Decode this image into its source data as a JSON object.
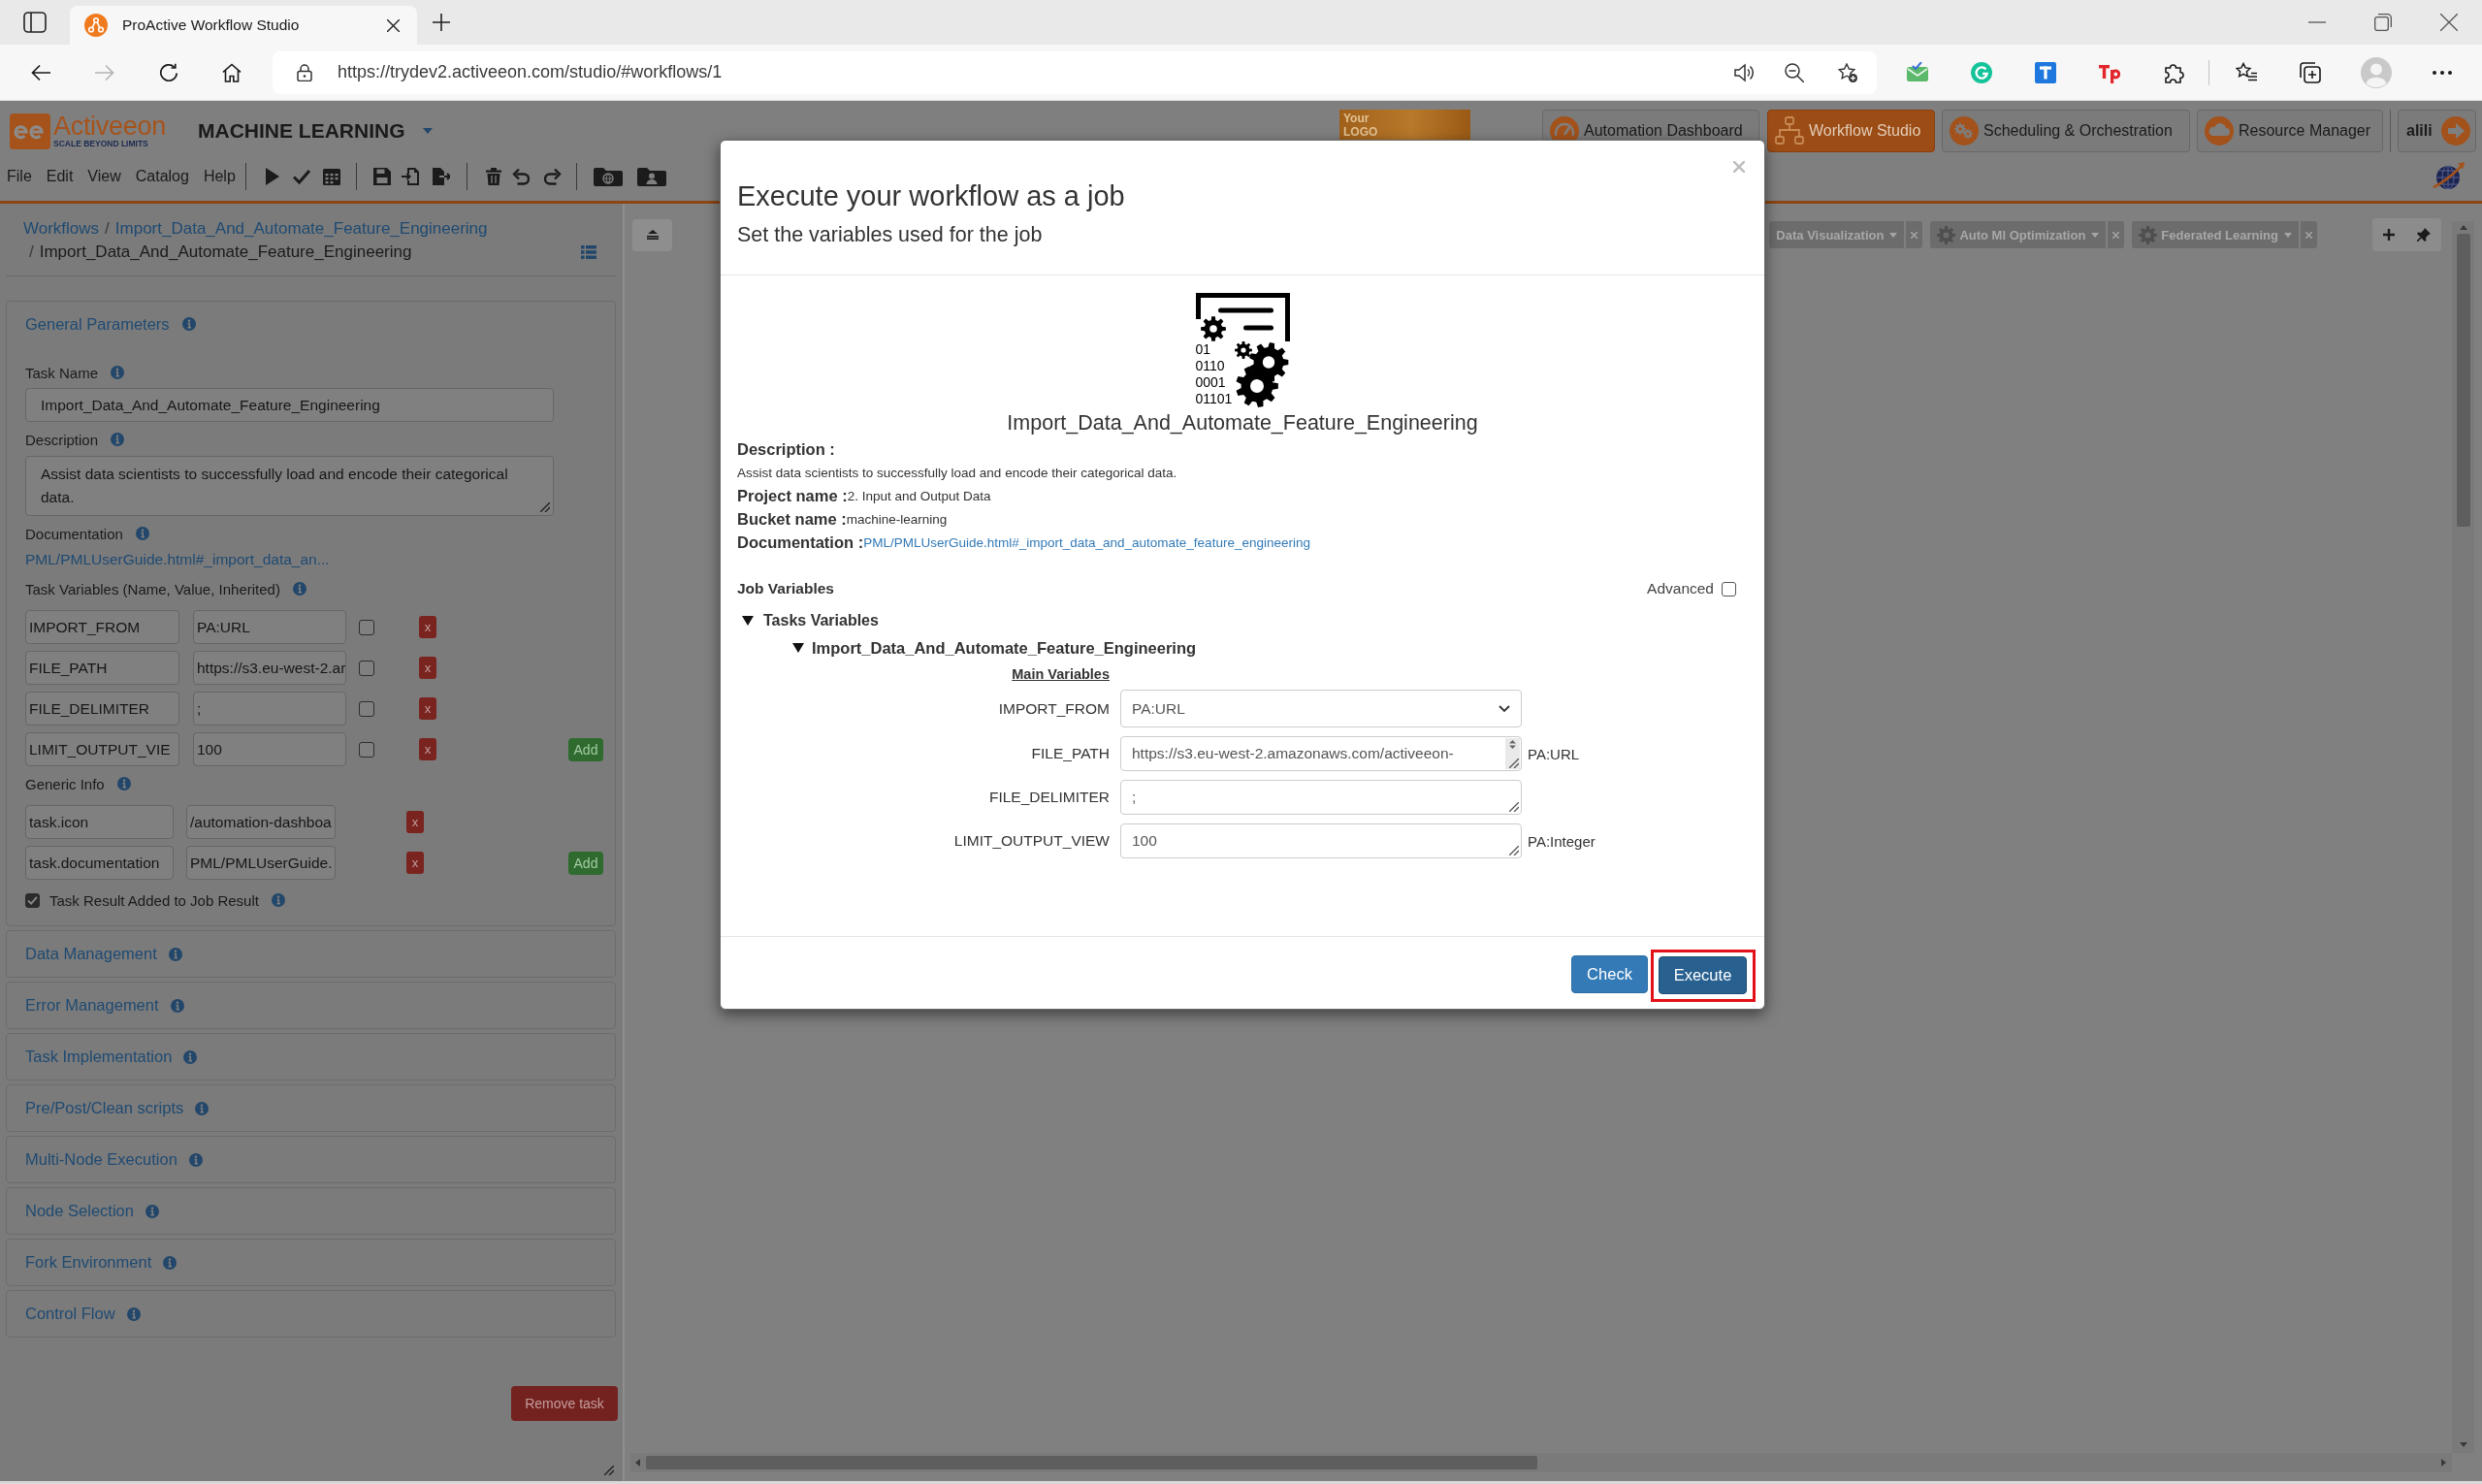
{
  "browser": {
    "tab_title": "ProActive Workflow Studio",
    "url": "https://trydev2.activeeon.com/studio/#workflows/1"
  },
  "header": {
    "logo": {
      "name": "Activeeon",
      "tagline": "SCALE BEYOND LIMITS"
    },
    "portal": "MACHINE LEARNING",
    "custom_logo": "Your LOGO",
    "nav": [
      {
        "label": "Automation Dashboard",
        "selected": false
      },
      {
        "label": "Workflow Studio",
        "selected": true
      },
      {
        "label": "Scheduling & Orchestration",
        "selected": false
      },
      {
        "label": "Resource Manager",
        "selected": false
      }
    ],
    "user": "alili"
  },
  "menu": [
    "File",
    "Edit",
    "View",
    "Catalog",
    "Help"
  ],
  "task_panel": {
    "breadcrumb": [
      {
        "label": "Workflows",
        "link": true
      },
      {
        "separator": "/",
        "label": "Import_Data_And_Automate_Feature_Engineering",
        "link": true
      },
      {
        "separator": "/",
        "label": "Import_Data_And_Automate_Feature_Engineering",
        "link": false
      }
    ],
    "general": {
      "title": "General Parameters",
      "task_name": {
        "label": "Task Name",
        "value": "Import_Data_And_Automate_Feature_Engineering"
      },
      "description": {
        "label": "Description",
        "value": "Assist data scientists to successfully load and encode their categorical data."
      },
      "documentation": {
        "label": "Documentation",
        "link": "PML/PMLUserGuide.html#_import_data_an..."
      },
      "variables": {
        "label": "Task Variables (Name, Value, Inherited)",
        "rows": [
          {
            "name": "IMPORT_FROM",
            "value": "PA:URL",
            "inherited": false,
            "remove": "x"
          },
          {
            "name": "FILE_PATH",
            "value": "https://s3.eu-west-2.ar",
            "inherited": false,
            "remove": "x"
          },
          {
            "name": "FILE_DELIMITER",
            "value": ";",
            "inherited": false,
            "remove": "x"
          },
          {
            "name": "LIMIT_OUTPUT_VIE",
            "value": "100",
            "inherited": false,
            "remove": "x"
          }
        ],
        "add": "Add"
      },
      "generic_info": {
        "label": "Generic Info",
        "rows": [
          {
            "name": "task.icon",
            "value": "/automation-dashboa",
            "remove": "x"
          },
          {
            "name": "task.documentation",
            "value": "PML/PMLUserGuide.",
            "remove": "x"
          }
        ],
        "add": "Add"
      },
      "result": {
        "label": "Task Result Added to Job Result",
        "checked": true
      }
    },
    "sections": [
      "Data Management",
      "Error Management",
      "Task Implementation",
      "Pre/Post/Clean scripts",
      "Multi-Node Execution",
      "Node Selection",
      "Fork Environment",
      "Control Flow"
    ],
    "remove_button": "Remove task"
  },
  "canvas": {
    "palettes": [
      {
        "label": "Data Visualization",
        "icon": false
      },
      {
        "label": "Auto Ml Optimization",
        "icon": true
      },
      {
        "label": "Federated Learning",
        "icon": true
      }
    ]
  },
  "modal": {
    "title": "Execute your workflow as a job",
    "subtitle": "Set the variables used for the job",
    "digits": [
      "01",
      "0110",
      "0001",
      "01101"
    ],
    "workflow_name": "Import_Data_And_Automate_Feature_Engineering",
    "details": [
      {
        "label": "Description :",
        "value": "Assist data scientists to successfully load and encode their categorical data.",
        "kind": "block"
      },
      {
        "label": "Project name :",
        "value": "2. Input and Output Data",
        "kind": "inline"
      },
      {
        "label": "Bucket name :",
        "value": "machine-learning",
        "kind": "inline"
      },
      {
        "label": "Documentation :",
        "value": "PML/PMLUserGuide.html#_import_data_and_automate_feature_engineering",
        "kind": "link"
      }
    ],
    "job_variables": {
      "title": "Job Variables",
      "advanced": {
        "label": "Advanced",
        "checked": false
      },
      "tree": [
        {
          "label": "Tasks Variables",
          "expanded": true,
          "children": [
            {
              "label": "Import_Data_And_Automate_Feature_Engineering",
              "expanded": true,
              "group": "Main Variables",
              "variables": [
                {
                  "name": "IMPORT_FROM",
                  "kind": "select",
                  "value": "PA:URL"
                },
                {
                  "name": "FILE_PATH",
                  "kind": "textarea",
                  "value": "https://s3.eu-west-2.amazonaws.com/activeeon-",
                  "type": "PA:URL",
                  "overflowing": true
                },
                {
                  "name": "FILE_DELIMITER",
                  "kind": "textarea",
                  "value": ";",
                  "overflowing": false
                },
                {
                  "name": "LIMIT_OUTPUT_VIEW",
                  "kind": "textarea",
                  "value": "100",
                  "type": "PA:Integer",
                  "overflowing": false
                }
              ]
            }
          ]
        }
      ]
    },
    "buttons": [
      {
        "label": "Check",
        "kind": "secondary",
        "highlighted": false
      },
      {
        "label": "Execute",
        "kind": "primary",
        "highlighted": true
      }
    ]
  }
}
